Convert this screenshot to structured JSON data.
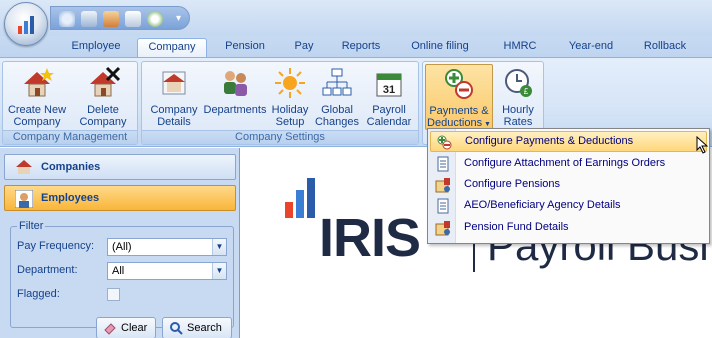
{
  "app": {
    "orb_icon": "iris-logo-icon",
    "qat_icons": [
      "refresh-icon",
      "save-icon",
      "users-icon",
      "org-icon",
      "document-icon"
    ]
  },
  "tabs": [
    {
      "label": "Employee"
    },
    {
      "label": "Company",
      "active": true
    },
    {
      "label": "Pension"
    },
    {
      "label": "Pay"
    },
    {
      "label": "Reports"
    },
    {
      "label": "Online filing"
    },
    {
      "label": "HMRC"
    },
    {
      "label": "Year-end"
    },
    {
      "label": "Rollback"
    }
  ],
  "ribbon": {
    "groups": [
      {
        "label": "Company Management",
        "buttons": [
          {
            "line1": "Create New",
            "line2": "Company",
            "icon": "house-star-icon"
          },
          {
            "line1": "Delete",
            "line2": "Company",
            "icon": "house-delete-icon"
          }
        ]
      },
      {
        "label": "Company Settings",
        "buttons": [
          {
            "line1": "Company",
            "line2": "Details",
            "icon": "company-details-icon"
          },
          {
            "line1": "Departments",
            "line2": "",
            "icon": "people-icon"
          },
          {
            "line1": "Holiday",
            "line2": "Setup",
            "icon": "sun-icon"
          },
          {
            "line1": "Global",
            "line2": "Changes",
            "icon": "org-chart-icon"
          },
          {
            "line1": "Payroll",
            "line2": "Calendar",
            "icon": "calendar-icon"
          }
        ]
      },
      {
        "label": "",
        "buttons": [
          {
            "line1": "Payments &",
            "line2": "Deductions",
            "icon": "payments-deductions-icon",
            "has_dropdown": true
          },
          {
            "line1": "Hourly",
            "line2": "Rates",
            "icon": "clock-icon"
          }
        ]
      }
    ]
  },
  "nav": {
    "companies_label": "Companies",
    "employees_label": "Employees"
  },
  "filter": {
    "legend": "Filter",
    "pay_frequency_label": "Pay Frequency:",
    "pay_frequency_value": "(All)",
    "department_label": "Department:",
    "department_value": "All",
    "flagged_label": "Flagged:",
    "clear_label": "Clear",
    "search_label": "Search"
  },
  "logo": {
    "brand": "IRIS",
    "subtitle": "Payroll Busi"
  },
  "menu": {
    "items": [
      {
        "label": "Configure Payments & Deductions",
        "icon": "payments-deductions-icon",
        "highlighted": true
      },
      {
        "label": "Configure Attachment of Earnings Orders",
        "icon": "document-icon"
      },
      {
        "label": "Configure Pensions",
        "icon": "pension-icon"
      },
      {
        "label": "AEO/Beneficiary Agency Details",
        "icon": "document-icon"
      },
      {
        "label": "Pension Fund Details",
        "icon": "pension-icon"
      }
    ]
  },
  "colors": {
    "accent_orange": "#f9b63a",
    "ribbon_text": "#15428b",
    "menu_highlight": "#ffd77b"
  }
}
